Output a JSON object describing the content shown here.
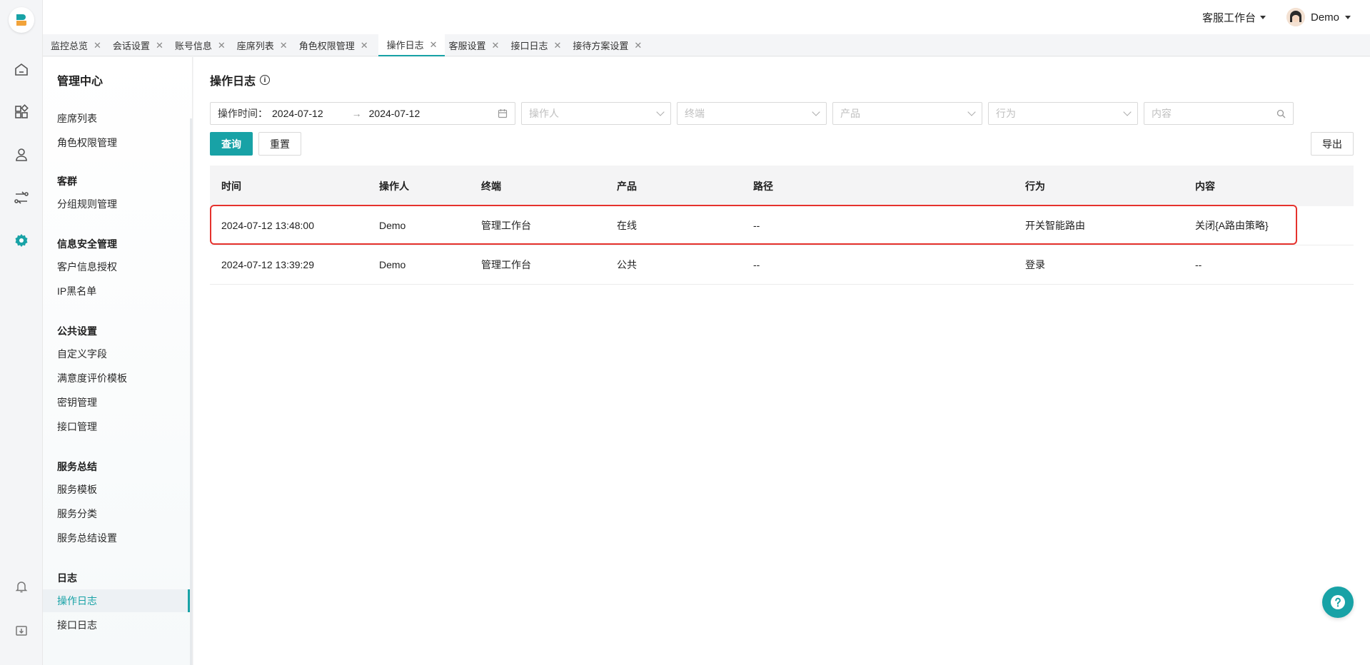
{
  "topbar": {
    "workspace": "客服工作台",
    "user": "Demo"
  },
  "tabs": [
    {
      "label": "监控总览"
    },
    {
      "label": "会话设置"
    },
    {
      "label": "账号信息"
    },
    {
      "label": "座席列表"
    },
    {
      "label": "角色权限管理"
    },
    {
      "label": "操作日志"
    },
    {
      "label": "客服设置"
    },
    {
      "label": "接口日志"
    },
    {
      "label": "接待方案设置"
    }
  ],
  "sidebar": {
    "title": "管理中心",
    "items": [
      "座席列表",
      "角色权限管理"
    ],
    "groups": [
      {
        "title": "客群",
        "items": [
          "分组规则管理"
        ]
      },
      {
        "title": "信息安全管理",
        "items": [
          "客户信息授权",
          "IP黑名单"
        ]
      },
      {
        "title": "公共设置",
        "items": [
          "自定义字段",
          "满意度评价模板",
          "密钥管理",
          "接口管理"
        ]
      },
      {
        "title": "服务总结",
        "items": [
          "服务模板",
          "服务分类",
          "服务总结设置"
        ]
      },
      {
        "title": "日志",
        "items": [
          "操作日志",
          "接口日志"
        ]
      }
    ]
  },
  "page": {
    "title": "操作日志"
  },
  "filters": {
    "date_label": "操作时间：",
    "date_start": "2024-07-12",
    "date_end": "2024-07-12",
    "operator_placeholder": "操作人",
    "terminal_placeholder": "终端",
    "product_placeholder": "产品",
    "action_placeholder": "行为",
    "content_placeholder": "内容"
  },
  "buttons": {
    "query": "查询",
    "reset": "重置",
    "export": "导出"
  },
  "table": {
    "headers": [
      "时间",
      "操作人",
      "终端",
      "产品",
      "路径",
      "行为",
      "内容"
    ],
    "rows": [
      [
        "2024-07-12 13:48:00",
        "Demo",
        "管理工作台",
        "在线",
        "--",
        "开关智能路由",
        "关闭{A路由策略}"
      ],
      [
        "2024-07-12 13:39:29",
        "Demo",
        "管理工作台",
        "公共",
        "--",
        "登录",
        "--"
      ]
    ]
  },
  "colors": {
    "accent": "#18a2a6",
    "highlight": "#e5322d"
  }
}
